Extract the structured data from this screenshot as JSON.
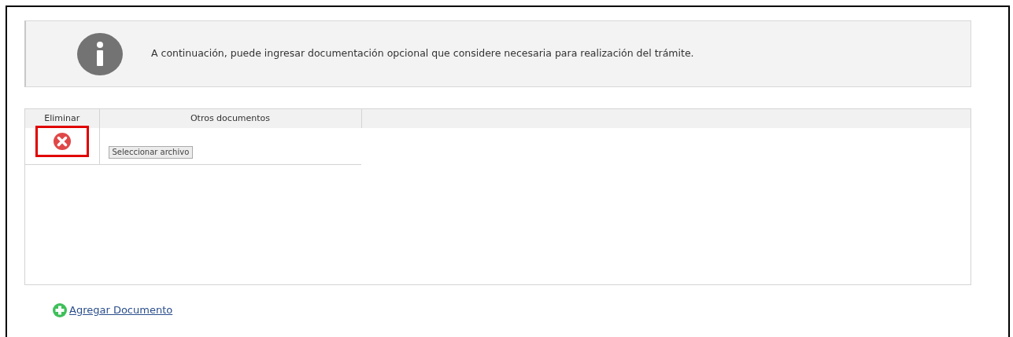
{
  "info_message": "A continuación, puede ingresar documentación opcional que considere necesaria para realización del trámite.",
  "table": {
    "columns": [
      "Eliminar",
      "Otros documentos"
    ],
    "rows": [
      {
        "delete_highlighted": true,
        "file_button": "Seleccionar archivo"
      }
    ]
  },
  "add_link": "Agregar Documento"
}
